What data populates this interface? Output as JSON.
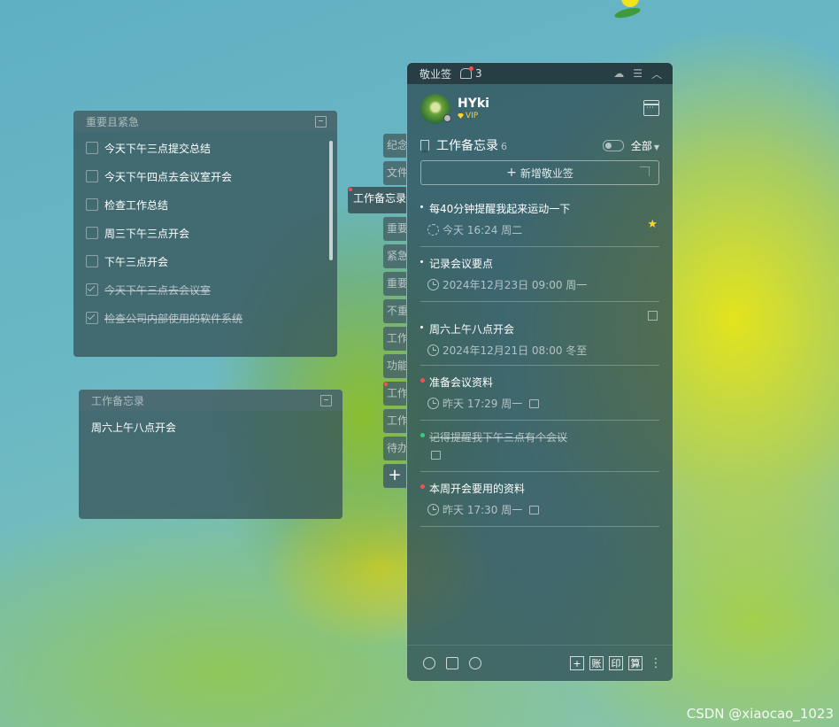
{
  "note1": {
    "title": "重要且紧急",
    "tasks": [
      {
        "text": "今天下午三点提交总结",
        "done": false
      },
      {
        "text": "今天下午四点去会议室开会",
        "done": false
      },
      {
        "text": "检查工作总结",
        "done": false
      },
      {
        "text": "周三下午三点开会",
        "done": false
      },
      {
        "text": "下午三点开会",
        "done": false
      },
      {
        "text": "今天下午三点去会议室",
        "done": true
      },
      {
        "text": "检查公司内部使用的软件系统",
        "done": true
      }
    ]
  },
  "note2": {
    "title": "工作备忘录",
    "content": "周六上午八点开会"
  },
  "tabs": [
    "纪念",
    "文件",
    "工作备忘录",
    "重要",
    "紧急",
    "重要",
    "不重",
    "工作",
    "功能",
    "工作",
    "工作",
    "待办"
  ],
  "tab_add": "+",
  "panel": {
    "app_name": "敬业签",
    "notif_count": "3",
    "user": {
      "name": "HYki",
      "vip": "VIP"
    },
    "category": {
      "title": "工作备忘录",
      "count": "6",
      "filter": "全部"
    },
    "add_label": "新增敬业签",
    "items": [
      {
        "title": "每40分钟提醒我起来运动一下",
        "meta": "今天 16:24 周二",
        "bullet": "white",
        "icon": "repeat",
        "starred": true,
        "lock": false,
        "strike": false
      },
      {
        "title": "记录会议要点",
        "meta": "2024年12月23日 09:00 周一",
        "bullet": "white",
        "icon": "clock",
        "starred": false,
        "lock": false,
        "strike": false
      },
      {
        "title": "周六上午八点开会",
        "meta": "2024年12月21日 08:00 冬至",
        "bullet": "white",
        "icon": "clock",
        "starred": false,
        "lock": false,
        "strike": false
      },
      {
        "title": "准备会议资料",
        "meta": "昨天 17:29 周一",
        "bullet": "red",
        "icon": "clock",
        "starred": false,
        "lock": true,
        "strike": false
      },
      {
        "title": "记得提醒我下午三点有个会议",
        "meta": "",
        "bullet": "green",
        "icon": "none",
        "starred": false,
        "lock": true,
        "strike": true
      },
      {
        "title": "本周开会要用的资料",
        "meta": "昨天 17:30 周一",
        "bullet": "red",
        "icon": "clock",
        "starred": false,
        "lock": true,
        "strike": false
      }
    ],
    "footer": {
      "add": "+",
      "ledger": "账",
      "print": "印",
      "calc": "算"
    }
  },
  "watermark": "CSDN @xiaocao_1023",
  "colors": {
    "red_dot": "#ff4d4f",
    "green_dot": "#2fd07a",
    "star": "#ffd42a",
    "vip": "#ffd42a"
  }
}
